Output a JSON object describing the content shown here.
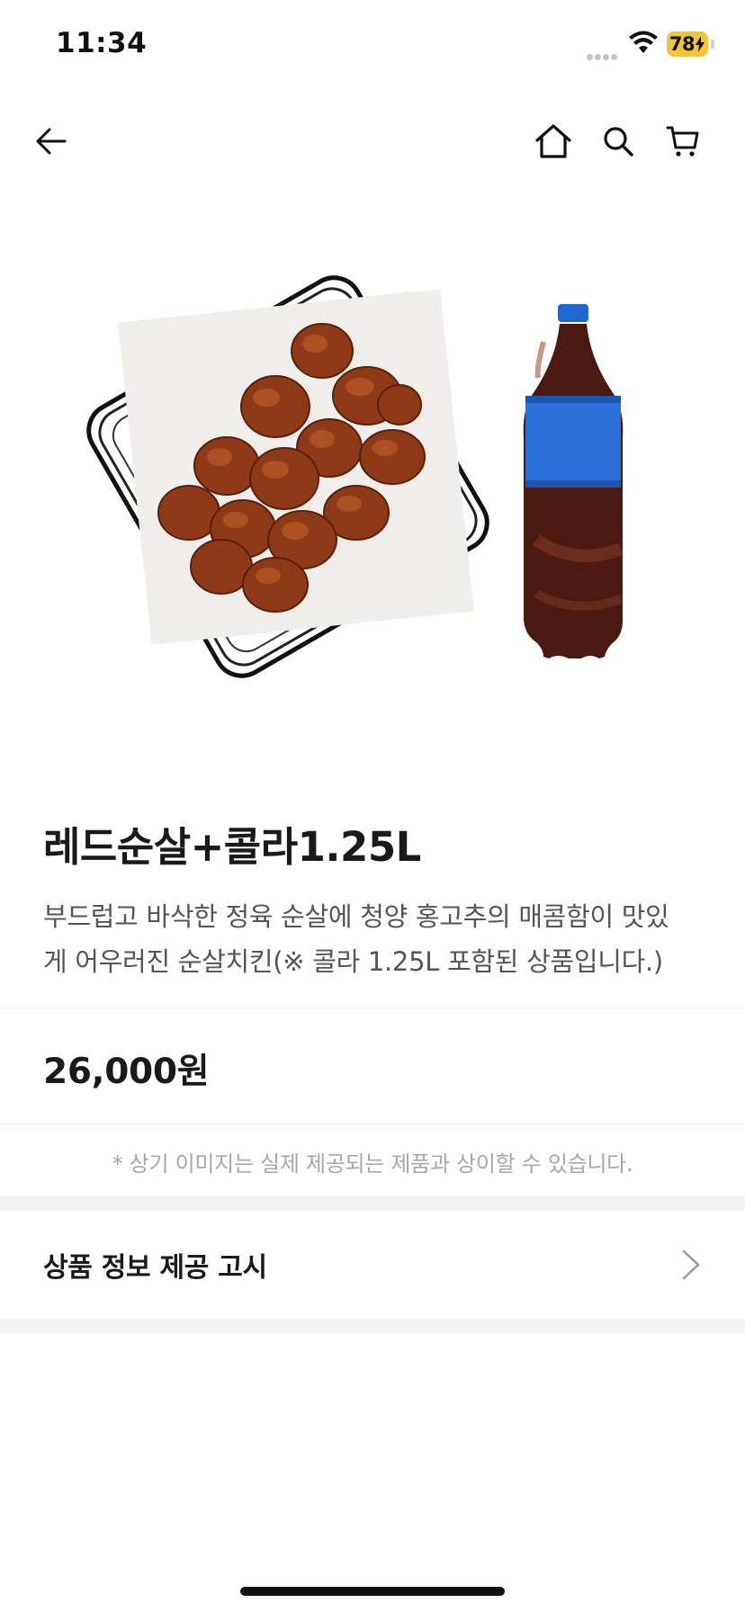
{
  "status_bar": {
    "time": "11:34",
    "battery": "78"
  },
  "nav": {
    "back_icon": "arrow-left-icon",
    "home_icon": "home-icon",
    "search_icon": "search-icon",
    "cart_icon": "cart-icon"
  },
  "product": {
    "title": "레드순살+콜라1.25L",
    "description_line1": "부드럽고 바삭한 정육 순살에 청양 홍고추의 매콤함이 맛있",
    "description_line2": "게 어우러진 순살치킨(※ 콜라 1.25L 포함된 상품입니다.)",
    "price": "26,000원"
  },
  "notice": "* 상기 이미지는 실제 제공되는 제품과 상이할 수 있습니다.",
  "info_section": {
    "label": "상품 정보 제공 고시"
  },
  "colors": {
    "battery": "#f2c43a",
    "cola_label": "#2a6fd6",
    "cap": "#1f66d1"
  }
}
